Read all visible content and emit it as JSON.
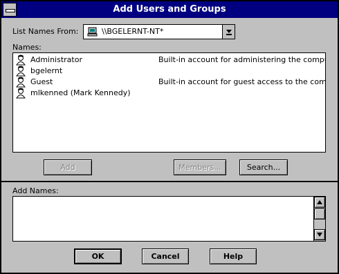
{
  "window": {
    "title": "Add Users and Groups"
  },
  "list_names_from": {
    "label": "List Names From:",
    "value": "\\\\BGELERNT-NT*"
  },
  "names": {
    "label": "Names:",
    "rows": [
      {
        "name": "Administrator",
        "description": "Built-in account for administering the computer/dom"
      },
      {
        "name": "bgelernt",
        "description": ""
      },
      {
        "name": "Guest",
        "description": "Built-in account for guest access to the computer/d"
      },
      {
        "name": "mlkenned (Mark Kennedy)",
        "description": ""
      }
    ]
  },
  "buttons": {
    "add": "Add",
    "members": "Members...",
    "search": "Search...",
    "ok": "OK",
    "cancel": "Cancel",
    "help": "Help"
  },
  "add_names": {
    "label": "Add Names:",
    "value": ""
  },
  "colors": {
    "titlebar": "#000080",
    "face": "#c0c0c0",
    "disabled_text": "#808080"
  },
  "icons": {
    "user": "user-icon",
    "computer": "computer-icon"
  }
}
